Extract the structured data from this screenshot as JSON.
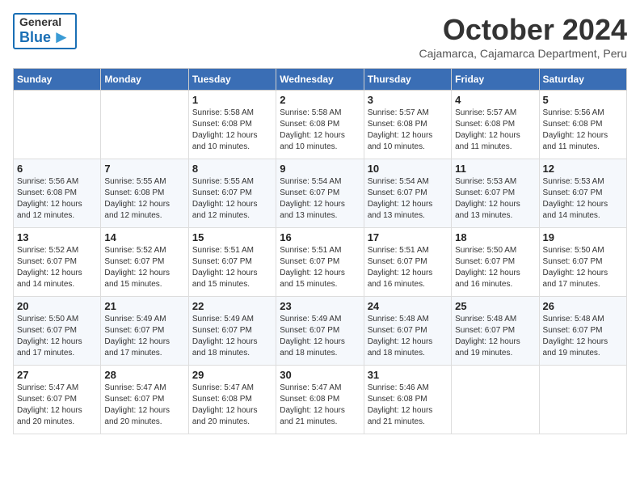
{
  "header": {
    "logo_general": "General",
    "logo_blue": "Blue",
    "month_title": "October 2024",
    "location": "Cajamarca, Cajamarca Department, Peru"
  },
  "weekdays": [
    "Sunday",
    "Monday",
    "Tuesday",
    "Wednesday",
    "Thursday",
    "Friday",
    "Saturday"
  ],
  "weeks": [
    [
      {
        "day": "",
        "info": ""
      },
      {
        "day": "",
        "info": ""
      },
      {
        "day": "1",
        "info": "Sunrise: 5:58 AM\nSunset: 6:08 PM\nDaylight: 12 hours\nand 10 minutes."
      },
      {
        "day": "2",
        "info": "Sunrise: 5:58 AM\nSunset: 6:08 PM\nDaylight: 12 hours\nand 10 minutes."
      },
      {
        "day": "3",
        "info": "Sunrise: 5:57 AM\nSunset: 6:08 PM\nDaylight: 12 hours\nand 10 minutes."
      },
      {
        "day": "4",
        "info": "Sunrise: 5:57 AM\nSunset: 6:08 PM\nDaylight: 12 hours\nand 11 minutes."
      },
      {
        "day": "5",
        "info": "Sunrise: 5:56 AM\nSunset: 6:08 PM\nDaylight: 12 hours\nand 11 minutes."
      }
    ],
    [
      {
        "day": "6",
        "info": "Sunrise: 5:56 AM\nSunset: 6:08 PM\nDaylight: 12 hours\nand 12 minutes."
      },
      {
        "day": "7",
        "info": "Sunrise: 5:55 AM\nSunset: 6:08 PM\nDaylight: 12 hours\nand 12 minutes."
      },
      {
        "day": "8",
        "info": "Sunrise: 5:55 AM\nSunset: 6:07 PM\nDaylight: 12 hours\nand 12 minutes."
      },
      {
        "day": "9",
        "info": "Sunrise: 5:54 AM\nSunset: 6:07 PM\nDaylight: 12 hours\nand 13 minutes."
      },
      {
        "day": "10",
        "info": "Sunrise: 5:54 AM\nSunset: 6:07 PM\nDaylight: 12 hours\nand 13 minutes."
      },
      {
        "day": "11",
        "info": "Sunrise: 5:53 AM\nSunset: 6:07 PM\nDaylight: 12 hours\nand 13 minutes."
      },
      {
        "day": "12",
        "info": "Sunrise: 5:53 AM\nSunset: 6:07 PM\nDaylight: 12 hours\nand 14 minutes."
      }
    ],
    [
      {
        "day": "13",
        "info": "Sunrise: 5:52 AM\nSunset: 6:07 PM\nDaylight: 12 hours\nand 14 minutes."
      },
      {
        "day": "14",
        "info": "Sunrise: 5:52 AM\nSunset: 6:07 PM\nDaylight: 12 hours\nand 15 minutes."
      },
      {
        "day": "15",
        "info": "Sunrise: 5:51 AM\nSunset: 6:07 PM\nDaylight: 12 hours\nand 15 minutes."
      },
      {
        "day": "16",
        "info": "Sunrise: 5:51 AM\nSunset: 6:07 PM\nDaylight: 12 hours\nand 15 minutes."
      },
      {
        "day": "17",
        "info": "Sunrise: 5:51 AM\nSunset: 6:07 PM\nDaylight: 12 hours\nand 16 minutes."
      },
      {
        "day": "18",
        "info": "Sunrise: 5:50 AM\nSunset: 6:07 PM\nDaylight: 12 hours\nand 16 minutes."
      },
      {
        "day": "19",
        "info": "Sunrise: 5:50 AM\nSunset: 6:07 PM\nDaylight: 12 hours\nand 17 minutes."
      }
    ],
    [
      {
        "day": "20",
        "info": "Sunrise: 5:50 AM\nSunset: 6:07 PM\nDaylight: 12 hours\nand 17 minutes."
      },
      {
        "day": "21",
        "info": "Sunrise: 5:49 AM\nSunset: 6:07 PM\nDaylight: 12 hours\nand 17 minutes."
      },
      {
        "day": "22",
        "info": "Sunrise: 5:49 AM\nSunset: 6:07 PM\nDaylight: 12 hours\nand 18 minutes."
      },
      {
        "day": "23",
        "info": "Sunrise: 5:49 AM\nSunset: 6:07 PM\nDaylight: 12 hours\nand 18 minutes."
      },
      {
        "day": "24",
        "info": "Sunrise: 5:48 AM\nSunset: 6:07 PM\nDaylight: 12 hours\nand 18 minutes."
      },
      {
        "day": "25",
        "info": "Sunrise: 5:48 AM\nSunset: 6:07 PM\nDaylight: 12 hours\nand 19 minutes."
      },
      {
        "day": "26",
        "info": "Sunrise: 5:48 AM\nSunset: 6:07 PM\nDaylight: 12 hours\nand 19 minutes."
      }
    ],
    [
      {
        "day": "27",
        "info": "Sunrise: 5:47 AM\nSunset: 6:07 PM\nDaylight: 12 hours\nand 20 minutes."
      },
      {
        "day": "28",
        "info": "Sunrise: 5:47 AM\nSunset: 6:07 PM\nDaylight: 12 hours\nand 20 minutes."
      },
      {
        "day": "29",
        "info": "Sunrise: 5:47 AM\nSunset: 6:08 PM\nDaylight: 12 hours\nand 20 minutes."
      },
      {
        "day": "30",
        "info": "Sunrise: 5:47 AM\nSunset: 6:08 PM\nDaylight: 12 hours\nand 21 minutes."
      },
      {
        "day": "31",
        "info": "Sunrise: 5:46 AM\nSunset: 6:08 PM\nDaylight: 12 hours\nand 21 minutes."
      },
      {
        "day": "",
        "info": ""
      },
      {
        "day": "",
        "info": ""
      }
    ]
  ]
}
